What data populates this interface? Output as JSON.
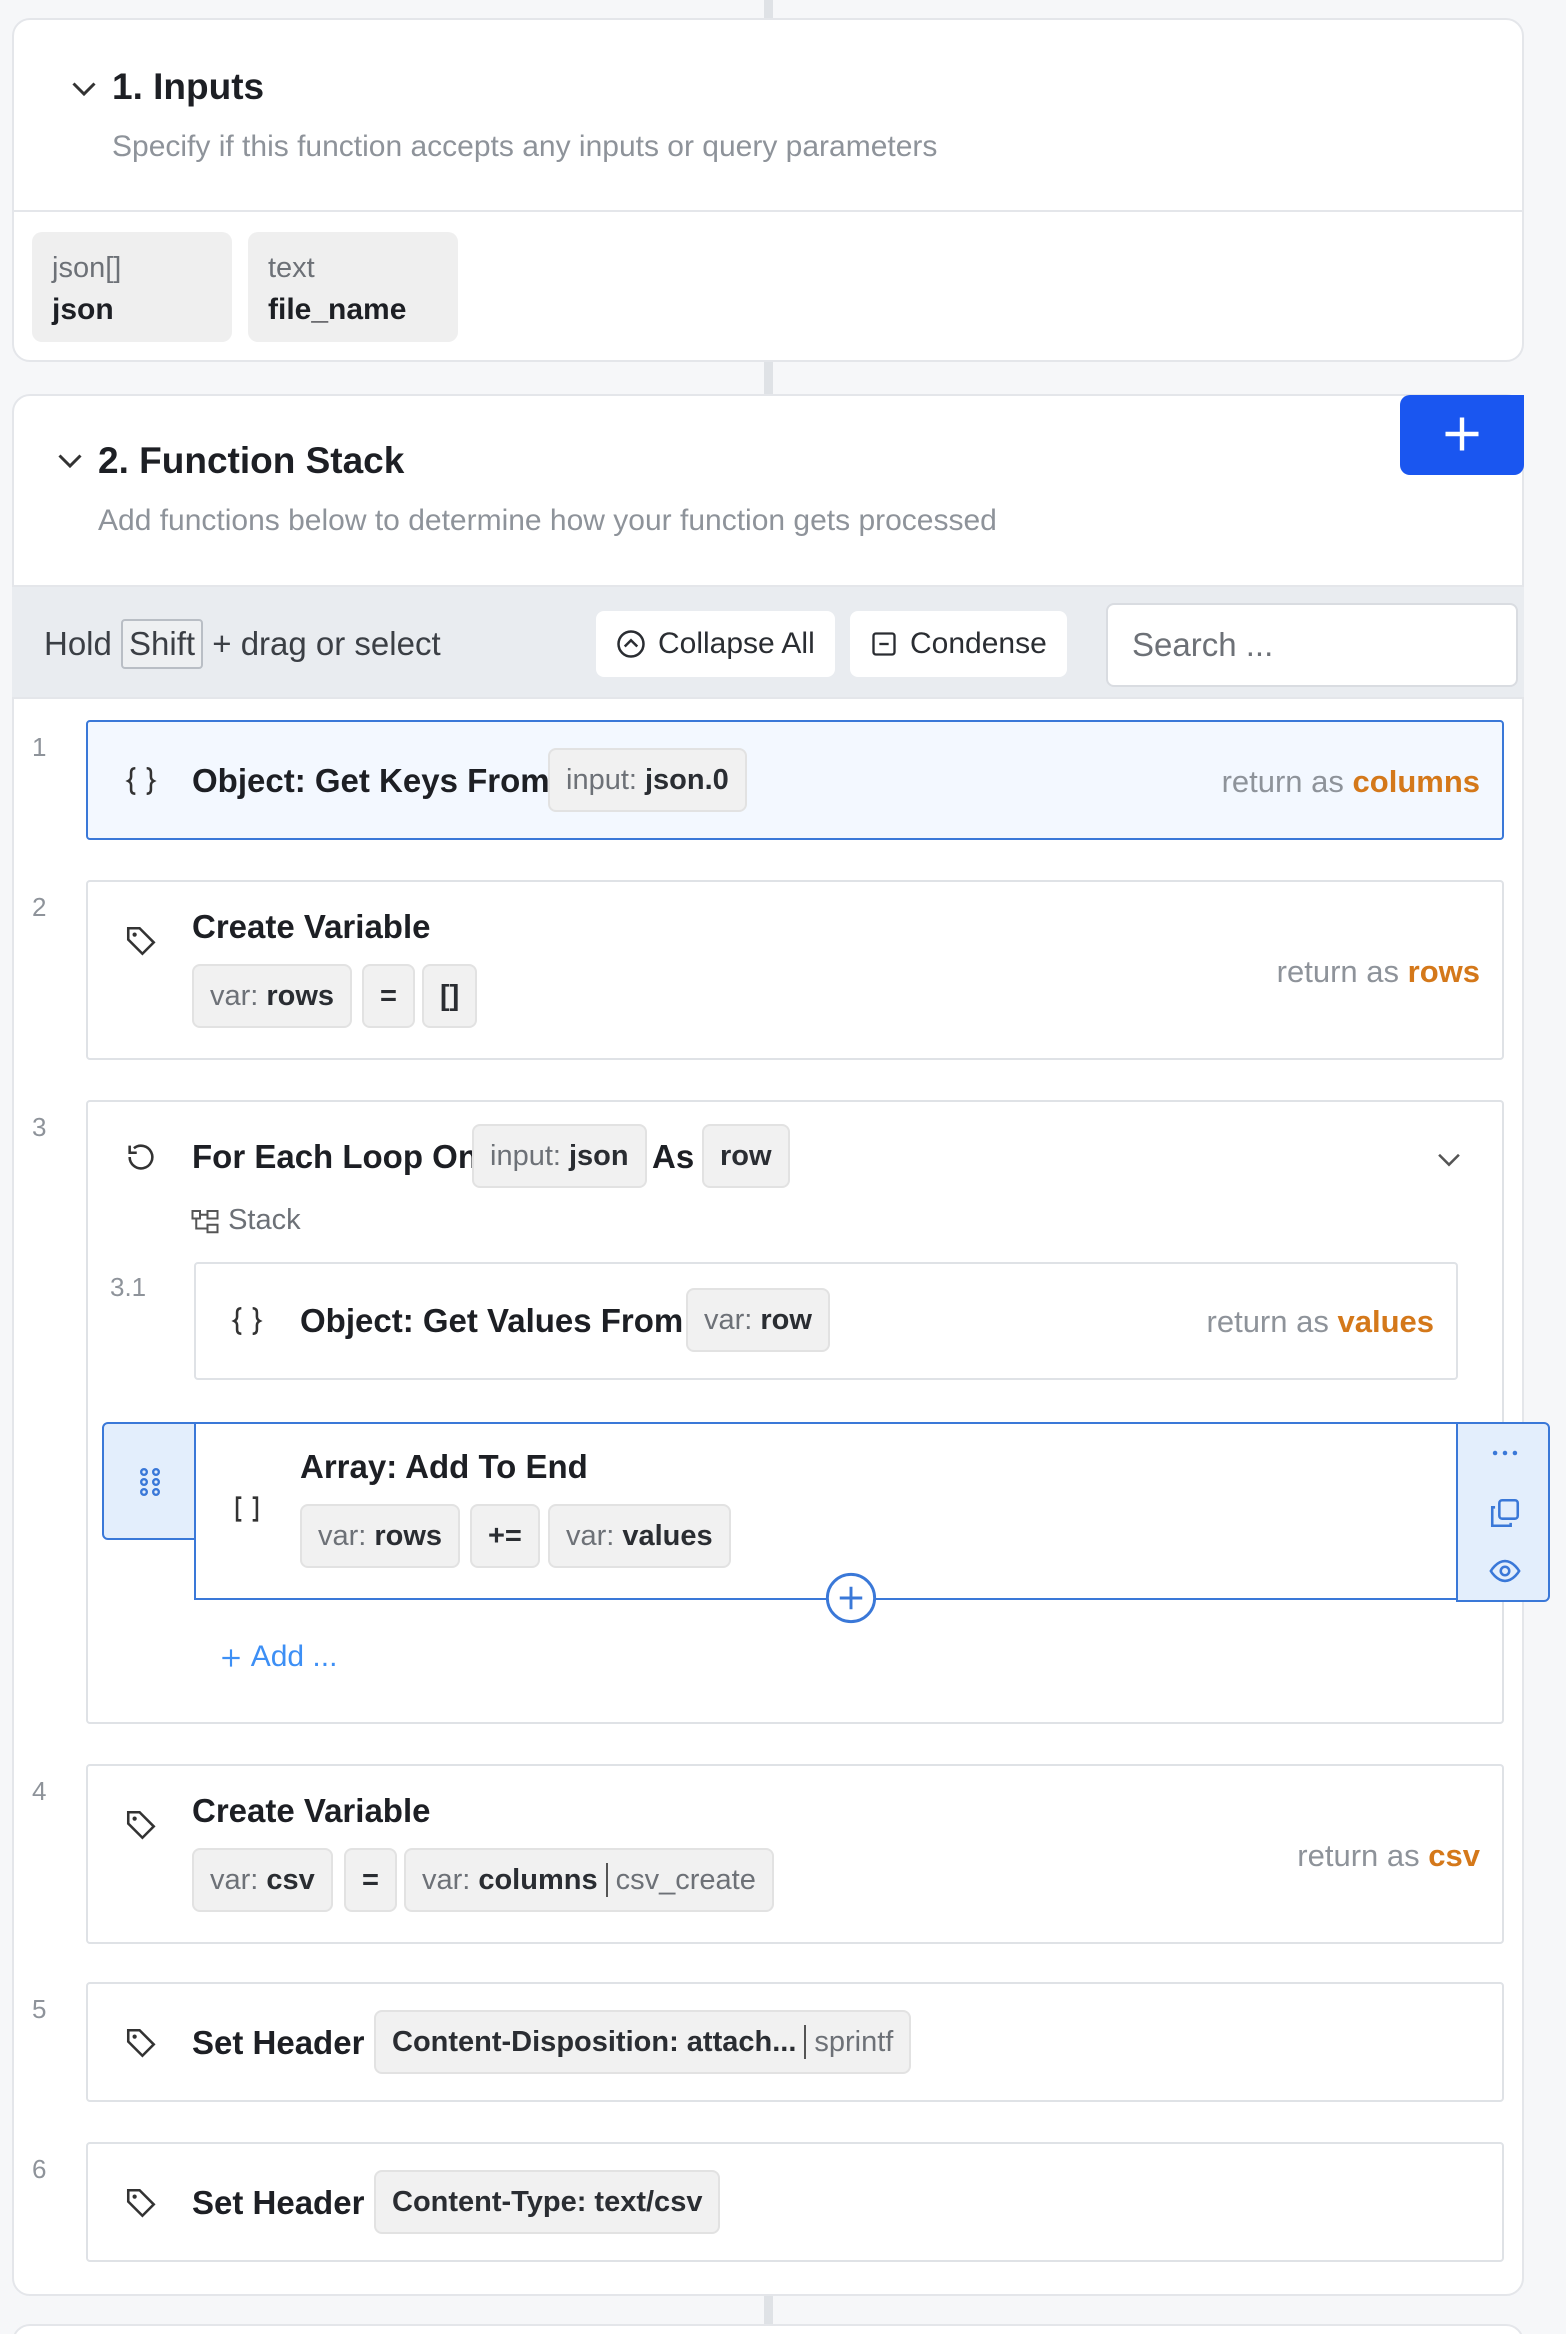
{
  "inputs_section": {
    "title": "1. Inputs",
    "description": "Specify if this function accepts any inputs or query parameters",
    "inputs": [
      {
        "type": "json[]",
        "name": "json"
      },
      {
        "type": "text",
        "name": "file_name"
      }
    ]
  },
  "function_stack": {
    "title": "2. Function Stack",
    "description": "Add functions below to determine how your function gets processed",
    "toolbar": {
      "hold": "Hold",
      "shift_key": "Shift",
      "hint": "+ drag or select",
      "collapse_all": "Collapse All",
      "condense": "Condense",
      "search_placeholder": "Search ..."
    },
    "return_as": "return as",
    "steps": [
      {
        "number": "1",
        "title": "Object: Get Keys From",
        "chip": {
          "prefix": "input:",
          "value": "json.0"
        },
        "return": "columns"
      },
      {
        "number": "2",
        "title": "Create Variable",
        "var_prefix": "var:",
        "var_name": "rows",
        "op": "=",
        "value": "[]",
        "return": "rows"
      },
      {
        "number": "3",
        "title": "For Each Loop On",
        "chip": {
          "prefix": "input:",
          "value": "json"
        },
        "as_label": "As",
        "as_value": "row",
        "stack_label": "Stack",
        "children": [
          {
            "number": "3.1",
            "title": "Object: Get Values From",
            "chip": {
              "prefix": "var:",
              "value": "row"
            },
            "return": "values"
          },
          {
            "title": "Array: Add To End",
            "var_prefix": "var:",
            "var_name": "rows",
            "op": "+=",
            "value_prefix": "var:",
            "value": "values"
          }
        ],
        "add_label": "Add ..."
      },
      {
        "number": "4",
        "title": "Create Variable",
        "var_prefix": "var:",
        "var_name": "csv",
        "op": "=",
        "value_prefix": "var:",
        "value": "columns",
        "filter": "csv_create",
        "return": "csv"
      },
      {
        "number": "5",
        "title": "Set Header",
        "chip": {
          "value": "Content-Disposition: attach...",
          "filter": "sprintf"
        }
      },
      {
        "number": "6",
        "title": "Set Header",
        "chip": {
          "value": "Content-Type: text/csv"
        }
      }
    ]
  },
  "colors": {
    "accent": "#1a56f0",
    "return_name": "#d4781a",
    "selected_border": "#3a78d8",
    "link": "#3d8ff5"
  },
  "icons": [
    "chevron-down-icon",
    "plus-icon",
    "collapse-icon",
    "condense-icon",
    "braces-icon",
    "tag-icon",
    "loop-icon",
    "stack-icon",
    "brackets-icon",
    "drag-handle-icon",
    "more-icon",
    "duplicate-icon",
    "eye-icon",
    "add-circle-icon"
  ]
}
